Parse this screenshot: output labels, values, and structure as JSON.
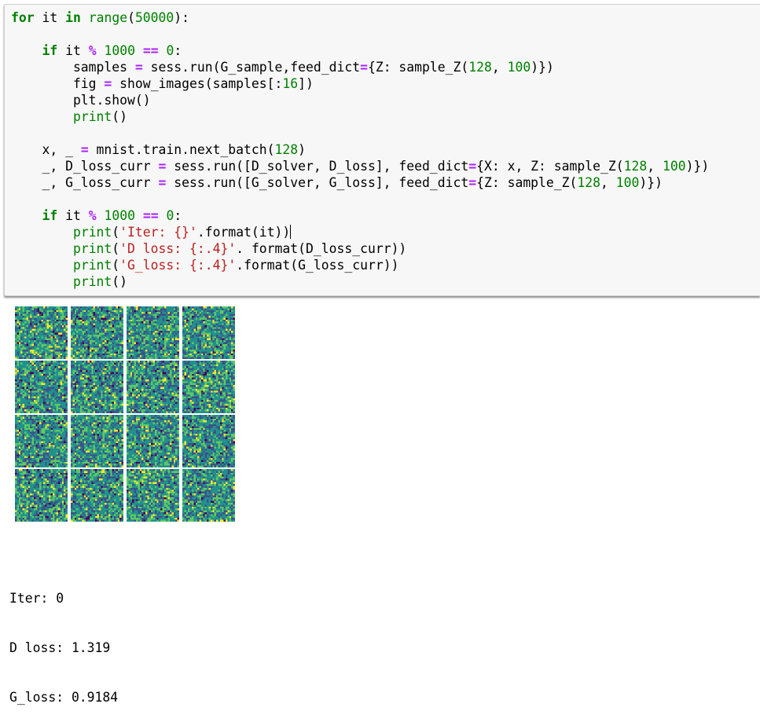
{
  "code_cell": {
    "lines": [
      [
        [
          "kw",
          "for"
        ],
        [
          "txt",
          " it "
        ],
        [
          "kw",
          "in"
        ],
        [
          "txt",
          " "
        ],
        [
          "bi",
          "range"
        ],
        [
          "txt",
          "("
        ],
        [
          "num",
          "50000"
        ],
        [
          "txt",
          "):"
        ]
      ],
      [],
      [
        [
          "txt",
          "    "
        ],
        [
          "kw",
          "if"
        ],
        [
          "txt",
          " it "
        ],
        [
          "op",
          "%"
        ],
        [
          "txt",
          " "
        ],
        [
          "num",
          "1000"
        ],
        [
          "txt",
          " "
        ],
        [
          "op",
          "=="
        ],
        [
          "txt",
          " "
        ],
        [
          "num",
          "0"
        ],
        [
          "txt",
          ":"
        ]
      ],
      [
        [
          "txt",
          "        samples "
        ],
        [
          "op",
          "="
        ],
        [
          "txt",
          " sess.run(G_sample,feed_dict"
        ],
        [
          "op",
          "="
        ],
        [
          "txt",
          "{Z: sample_Z("
        ],
        [
          "num",
          "128"
        ],
        [
          "txt",
          ", "
        ],
        [
          "num",
          "100"
        ],
        [
          "txt",
          ")})"
        ]
      ],
      [
        [
          "txt",
          "        fig "
        ],
        [
          "op",
          "="
        ],
        [
          "txt",
          " show_images(samples[:"
        ],
        [
          "num",
          "16"
        ],
        [
          "txt",
          "])"
        ]
      ],
      [
        [
          "txt",
          "        plt.show()"
        ]
      ],
      [
        [
          "txt",
          "        "
        ],
        [
          "bi",
          "print"
        ],
        [
          "txt",
          "()"
        ]
      ],
      [],
      [
        [
          "txt",
          "    x, _ "
        ],
        [
          "op",
          "="
        ],
        [
          "txt",
          " mnist.train.next_batch("
        ],
        [
          "num",
          "128"
        ],
        [
          "txt",
          ")"
        ]
      ],
      [
        [
          "txt",
          "    _, D_loss_curr "
        ],
        [
          "op",
          "="
        ],
        [
          "txt",
          " sess.run([D_solver, D_loss], feed_dict"
        ],
        [
          "op",
          "="
        ],
        [
          "txt",
          "{X: x, Z: sample_Z("
        ],
        [
          "num",
          "128"
        ],
        [
          "txt",
          ", "
        ],
        [
          "num",
          "100"
        ],
        [
          "txt",
          ")})"
        ]
      ],
      [
        [
          "txt",
          "    _, G_loss_curr "
        ],
        [
          "op",
          "="
        ],
        [
          "txt",
          " sess.run([G_solver, G_loss], feed_dict"
        ],
        [
          "op",
          "="
        ],
        [
          "txt",
          "{Z: sample_Z("
        ],
        [
          "num",
          "128"
        ],
        [
          "txt",
          ", "
        ],
        [
          "num",
          "100"
        ],
        [
          "txt",
          ")})"
        ]
      ],
      [],
      [
        [
          "txt",
          "    "
        ],
        [
          "kw",
          "if"
        ],
        [
          "txt",
          " it "
        ],
        [
          "op",
          "%"
        ],
        [
          "txt",
          " "
        ],
        [
          "num",
          "1000"
        ],
        [
          "txt",
          " "
        ],
        [
          "op",
          "=="
        ],
        [
          "txt",
          " "
        ],
        [
          "num",
          "0"
        ],
        [
          "txt",
          ":"
        ]
      ],
      [
        [
          "txt",
          "        "
        ],
        [
          "bi",
          "print"
        ],
        [
          "txt",
          "("
        ],
        [
          "str",
          "'Iter: {}'"
        ],
        [
          "txt",
          ".format(it))"
        ],
        [
          "cursor",
          ""
        ]
      ],
      [
        [
          "txt",
          "        "
        ],
        [
          "bi",
          "print"
        ],
        [
          "txt",
          "("
        ],
        [
          "str",
          "'D loss: {:.4}'"
        ],
        [
          "txt",
          ". format(D_loss_curr))"
        ]
      ],
      [
        [
          "txt",
          "        "
        ],
        [
          "bi",
          "print"
        ],
        [
          "txt",
          "("
        ],
        [
          "str",
          "'G_loss: {:.4}'"
        ],
        [
          "txt",
          ".format(G_loss_curr))"
        ]
      ],
      [
        [
          "txt",
          "        "
        ],
        [
          "bi",
          "print"
        ],
        [
          "txt",
          "()"
        ]
      ]
    ]
  },
  "sample_grid": {
    "rows": 4,
    "cols": 4,
    "pixels_per_side": 28,
    "colormap": [
      "#440154",
      "#3b528b",
      "#21918c",
      "#5ec962",
      "#fde725"
    ]
  },
  "output": {
    "lines": [
      "Iter: 0",
      "D loss: 1.319",
      "G_loss: 0.9184"
    ]
  }
}
